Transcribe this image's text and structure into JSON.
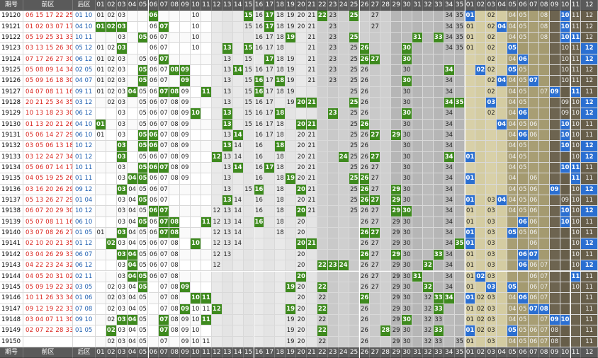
{
  "header": {
    "period": "期号",
    "front": "前区",
    "back": "后区",
    "cols": [
      "01",
      "02",
      "03",
      "04",
      "05",
      "06",
      "07",
      "08",
      "09",
      "10",
      "11",
      "12",
      "13",
      "14",
      "15",
      "16",
      "17",
      "18",
      "19",
      "20",
      "21",
      "22",
      "23",
      "24",
      "25",
      "26",
      "27",
      "28",
      "29",
      "30",
      "31",
      "32",
      "33",
      "34",
      "35",
      "01",
      "02",
      "03",
      "04",
      "05",
      "06",
      "07",
      "08",
      "09",
      "10",
      "11",
      "12"
    ]
  },
  "rows": [
    {
      "p": "19120",
      "f": "06 15 17 22 25",
      "b": "01 10",
      "z": "01 02 03 .. .. 06 .. .. .. 10 .. .. .. .. .. 16 .. 18 19 20 21 .. 23 .. .. .. 27 .. .. .. .. .. .. 34 35 01 .. 02 .. 04 05 .. 08 .. .. 11 12",
      "h": [
        6,
        15,
        17,
        22,
        25
      ],
      "bh": [
        1,
        10
      ]
    },
    {
      "p": "19121",
      "f": "01 02 03 07 17",
      "b": "04 10",
      "z": "01 02 03 .. .. 06 .. .. .. 10 .. .. .. .. 15 16 .. 18 19 20 21 .. 23 .. .. .. 27 .. .. .. .. .. .. 34 35 01 .. 02 .. 04 05 .. 08 .. .. 11 12",
      "h": [
        1,
        2,
        3,
        7,
        17
      ],
      "bh": [
        4,
        10
      ]
    },
    {
      "p": "19122",
      "f": "05 19 25 31 33",
      "b": "10 11",
      "z": ".. .. 03 .. .. 06 07 .. .. 10 .. .. .. .. .. 16 17 18 .. .. 21 .. 23 .. 25 .. .. .. .. .. .. .. .. 34 35 01 .. 02 .. 04 05 .. 08 .. .. 11 12",
      "h": [
        5,
        19,
        25,
        31,
        33
      ],
      "bh": [
        10,
        11
      ]
    },
    {
      "p": "19123",
      "f": "03 13 15 26 30",
      "b": "05 12",
      "z": "01 02 03 .. .. 06 07 .. .. 10 .. .. .. .. .. 16 17 18 .. .. 21 .. 23 .. 25 .. .. .. .. .. .. .. .. 34 35 01 .. 02 .. 04 .. .. .. .. 10 11 12",
      "h": [
        3,
        13,
        15,
        26,
        30
      ],
      "bh": [
        5,
        12
      ]
    },
    {
      "p": "19124",
      "f": "07 17 26 27 30",
      "b": "06 12",
      "z": "01 02 03 .. 05 06 07 .. .. .. .. .. 13 .. 15 .. 17 18 19 .. 21 .. 23 .. 25 26 .. .. .. .. .. .. .. .. .. .. .. 02 .. 04 05 .. .. .. 10 11 12",
      "h": [
        7,
        17,
        26,
        27,
        30
      ],
      "bh": [
        6,
        12
      ]
    },
    {
      "p": "19125",
      "f": "05 08 09 14 34",
      "b": "02 05",
      "z": "01 02 03 .. 05 06 07 .. .. .. .. .. 13 .. 15 16 17 18 19 .. 21 .. 23 .. 25 26 .. .. .. 30 .. .. .. .. .. .. .. 02 .. .. 05 .. .. .. 10 11 12",
      "h": [
        5,
        8,
        9,
        14,
        34
      ],
      "bh": [
        2,
        5
      ]
    },
    {
      "p": "19126",
      "f": "05 09 16 18 30",
      "b": "04 07",
      "z": "01 02 03 .. 05 06 07 .. 09 .. .. .. 13 .. 15 .. 17 .. 19 .. 21 .. 23 .. 25 26 .. .. .. 30 .. .. .. 34 .. .. .. 02 .. 04 05 .. .. .. 10 11 12",
      "h": [
        5,
        9,
        16,
        18,
        30
      ],
      "bh": [
        4,
        7
      ]
    },
    {
      "p": "19127",
      "f": "04 07 08 11 16",
      "b": "09 11",
      "z": "01 02 03 .. 05 06 07 .. 09 .. .. .. 13 .. 15 .. 17 18 19 .. .. .. .. .. 25 26 .. .. .. 30 .. .. .. 34 .. .. .. 02 .. 04 05 .. 07 .. .. 10 11 12",
      "h": [
        4,
        7,
        8,
        11,
        16
      ],
      "bh": [
        9,
        11
      ]
    },
    {
      "p": "19128",
      "f": "20 21 25 34 35",
      "b": "03 12",
      "z": ".. 02 03 .. 05 06 07 08 09 .. .. .. 13 .. 15 16 17 .. 19 .. .. .. .. .. 25 26 .. .. .. 30 .. .. .. 34 .. .. .. 02 .. 04 05 .. .. .. 09 10 11 12",
      "h": [
        20,
        21,
        25,
        34,
        35
      ],
      "bh": [
        3,
        12
      ]
    },
    {
      "p": "19129",
      "f": "10 13 18 23 30",
      "b": "06 12",
      "z": ".. .. 03 .. 05 06 07 08 09 .. .. .. 13 .. 15 16 17 .. .. .. .. .. .. .. 25 26 .. .. .. 30 .. .. .. 34 .. .. .. 02 .. 04 05 .. .. .. 09 10 11 12",
      "h": [
        10,
        13,
        18,
        23,
        30
      ],
      "bh": [
        6,
        12
      ]
    },
    {
      "p": "19130",
      "f": "01 13 20 21 26",
      "b": "04 10",
      "z": ".. .. 03 .. 05 06 07 08 09 .. .. .. 13 .. 15 16 17 18 .. .. .. .. .. .. 25 26 .. .. .. 30 .. .. .. 34 .. .. .. .. .. 04 05 06 .. .. 09 10 11 12",
      "h": [
        1,
        13,
        20,
        21,
        26
      ],
      "bh": [
        4,
        10
      ]
    },
    {
      "p": "19131",
      "f": "05 06 14 27 29",
      "b": "06 10",
      "z": "01 .. 03 .. 05 .. 07 08 09 .. .. .. 13 .. .. 16 17 18 .. 20 21 .. .. .. 25 26 .. .. .. 30 .. .. .. 34 .. .. .. .. .. 04 05 06 .. .. .. 10 11 12",
      "h": [
        5,
        6,
        14,
        27,
        29
      ],
      "bh": [
        6,
        10
      ]
    },
    {
      "p": "19132",
      "f": "03 05 06 13 18",
      "b": "10 12",
      "z": ".. .. 03 .. 05 .. 07 08 09 .. .. .. 13 14 .. 16 .. 18 .. 20 21 .. .. .. 25 26 .. .. .. 30 .. .. .. 34 .. .. .. .. .. 04 05 .. .. .. .. 10 11 12",
      "h": [
        3,
        5,
        6,
        13,
        18
      ],
      "bh": [
        10,
        12
      ]
    },
    {
      "p": "19133",
      "f": "03 12 24 27 34",
      "b": "01 12",
      "z": ".. .. 03 .. 05 06 07 08 09 .. .. .. 13 14 .. 16 .. 18 .. 20 21 .. .. .. 25 26 27 .. .. 30 .. .. .. 34 .. .. .. .. .. 04 05 .. .. .. .. 10 11 12",
      "h": [
        3,
        12,
        24,
        27,
        34
      ],
      "bh": [
        1,
        12
      ]
    },
    {
      "p": "19134",
      "f": "05 06 07 14 17",
      "b": "10 11",
      "z": ".. .. 03 .. 05 06 07 08 09 .. .. .. 13 14 .. 16 .. 18 .. 20 21 .. .. .. 25 26 27 .. .. 30 .. .. .. 34 .. .. .. .. .. 04 05 .. .. .. .. 10 11 12",
      "h": [
        5,
        6,
        7,
        14,
        17
      ],
      "bh": [
        10,
        11
      ]
    },
    {
      "p": "19135",
      "f": "04 05 19 25 26",
      "b": "01 11",
      "z": ".. .. 03 .. 05 06 07 08 09 .. .. .. 13 .. .. 16 .. 18 .. 20 21 .. .. .. 25 26 27 .. .. 30 .. .. .. 34 .. .. .. .. .. 04 .. 06 .. .. .. 10 11 12",
      "h": [
        4,
        5,
        19,
        25,
        26
      ],
      "bh": [
        1,
        11
      ]
    },
    {
      "p": "19136",
      "f": "03 16 20 26 29",
      "b": "09 12",
      "z": ".. .. 03 04 05 06 07 .. .. .. .. .. 13 .. 15 16 .. 18 .. 20 21 .. .. .. 25 26 27 .. .. 30 .. .. .. 34 .. .. .. .. .. 04 05 06 .. .. .. 10 11 12",
      "h": [
        3,
        16,
        20,
        26,
        29
      ],
      "bh": [
        9,
        12
      ]
    },
    {
      "p": "19137",
      "f": "05 13 26 27 29",
      "b": "01 04",
      "z": ".. .. 03 04 05 06 07 .. .. .. .. .. 13 14 .. 16 .. 18 .. 20 21 .. .. .. 25 26 27 .. 29 30 .. .. .. 34 .. 01 .. 03 .. 04 05 06 .. .. 09 10 11 12",
      "h": [
        5,
        13,
        26,
        27,
        29
      ],
      "bh": [
        1,
        4
      ]
    },
    {
      "p": "19138",
      "f": "06 07 20 29 30",
      "b": "10 12",
      "z": ".. .. 03 04 05 06 07 .. .. .. .. 12 13 14 .. 16 .. 18 .. 20 21 .. .. .. 25 26 27 .. 29 30 .. .. .. 34 .. 01 .. 03 .. 04 05 06 .. .. 09 10 11 12",
      "h": [
        6,
        7,
        20,
        29,
        30
      ],
      "bh": [
        10,
        12
      ]
    },
    {
      "p": "19139",
      "f": "05 07 08 11 16",
      "b": "06 10",
      "z": ".. .. 03 04 05 06 07 .. .. .. .. 12 13 14 .. .. .. 18 .. 20 .. .. .. .. .. 26 27 .. 29 30 .. .. .. 34 .. 01 .. 03 .. .. 05 06 .. .. .. 10 11 12",
      "h": [
        5,
        7,
        8,
        11,
        16
      ],
      "bh": [
        6,
        10
      ]
    },
    {
      "p": "19140",
      "f": "03 07 08 26 27",
      "b": "01 05",
      "z": "01 .. 03 04 05 06 07 .. .. .. .. 12 13 14 .. .. .. 18 .. 20 .. .. .. .. .. 26 27 .. 29 30 .. .. .. 34 .. 01 .. 03 .. .. 05 06 .. .. .. 10 11 12",
      "h": [
        3,
        7,
        8,
        26,
        27
      ],
      "bh": [
        1,
        5
      ]
    },
    {
      "p": "19141",
      "f": "02 10 20 21 35",
      "b": "01 12",
      "z": ".. .. 03 04 05 06 07 08 .. .. .. 12 13 14 .. .. .. .. .. 20 .. .. .. .. .. 26 27 .. 29 30 .. .. .. 34 .. 01 .. 03 .. .. .. 06 .. .. .. 10 11 12",
      "h": [
        2,
        10,
        20,
        21,
        35
      ],
      "bh": [
        1,
        12
      ]
    },
    {
      "p": "19142",
      "f": "03 04 26 29 33",
      "b": "06 07",
      "z": ".. .. 03 04 05 06 07 08 .. .. .. 12 13 .. .. .. .. .. .. 20 .. .. .. .. .. 26 27 .. 29 30 .. .. .. 34 .. 01 .. 03 .. .. .. 06 .. .. .. 10 11 12",
      "h": [
        3,
        4,
        26,
        29,
        33
      ],
      "bh": [
        6,
        7
      ]
    },
    {
      "p": "19143",
      "f": "04 22 23 24 32",
      "b": "06 12",
      "z": ".. .. 03 04 05 06 07 08 .. .. .. 12 .. .. .. .. .. .. .. 20 .. .. .. .. .. 26 27 .. 29 30 .. .. .. 34 .. 01 .. 03 .. .. .. 06 07 .. .. 10 11 12",
      "h": [
        4,
        22,
        23,
        24,
        32
      ],
      "bh": [
        6,
        12
      ]
    },
    {
      "p": "19144",
      "f": "04 05 20 31 02 11",
      "b": "02 11",
      "z": ".. .. 03 04 05 06 07 08 .. .. .. .. .. .. .. .. .. .. .. 20 .. .. .. .. .. 26 27 .. 29 30 .. .. .. 34 .. 01 .. 03 .. .. .. 06 07 .. .. 10 11 12",
      "h": [
        4,
        5,
        20,
        31
      ],
      "bh": [
        2,
        11
      ]
    },
    {
      "p": "19145",
      "f": "05 09 19 22 32",
      "b": "03 05",
      "z": ".. 02 03 04 05 .. 07 08 .. .. .. .. .. .. .. .. .. .. .. 20 .. .. .. .. .. 26 27 .. 29 30 .. .. .. 34 .. 01 .. 03 .. .. .. 06 07 .. .. 10 11 12",
      "h": [
        5,
        9,
        19,
        22,
        32
      ],
      "bh": [
        3,
        5
      ]
    },
    {
      "p": "19146",
      "f": "10 11 26 33 34",
      "b": "01 06",
      "z": ".. 02 03 04 05 .. 07 08 .. .. .. .. .. .. .. .. .. .. .. 20 .. 22 .. .. .. 26 .. .. 29 30 .. 32 .. .. .. .. 02 03 .. 04 05 06 07 .. .. .. 11 12",
      "h": [
        10,
        11,
        26,
        33,
        34
      ],
      "bh": [
        1,
        6
      ]
    },
    {
      "p": "19147",
      "f": "09 12 19 22 33",
      "b": "07 08",
      "z": ".. 02 03 04 05 .. 07 08 .. 10 11 .. .. .. .. .. .. .. .. 20 .. 22 .. .. .. 26 .. .. 29 30 .. 32 33 .. .. 01 02 03 .. 04 05 06 07 .. .. .. 11 12",
      "h": [
        9,
        12,
        19,
        22,
        33
      ],
      "bh": [
        7,
        8
      ]
    },
    {
      "p": "19148",
      "f": "03 04 07 11 30",
      "b": "09 10",
      "z": ".. 02 03 04 05 .. 07 08 09 10 11 .. .. .. .. .. .. .. 19 20 .. 22 .. .. .. 26 .. .. 29 30 .. 32 33 .. .. 01 02 03 .. 04 05 .. 07 .. .. .. 11 12",
      "h": [
        3,
        4,
        7,
        11,
        30
      ],
      "bh": [
        9,
        10
      ]
    },
    {
      "p": "19149",
      "f": "02 07 22 28 33",
      "b": "01 05",
      "z": ".. 02 03 04 05 .. 07 08 09 10 .. .. .. .. .. .. .. .. 19 20 .. 22 .. .. .. 26 .. .. 29 30 .. 32 33 .. .. 01 02 03 .. 04 05 06 07 08 .. .. 11 12",
      "h": [
        2,
        7,
        22,
        28,
        33
      ],
      "bh": [
        1,
        5
      ]
    },
    {
      "p": "19150",
      "f": "",
      "b": "",
      "z": ".. 02 03 04 05 .. 07 .. 09 10 11 .. .. .. .. .. .. .. 19 20 .. 22 .. .. .. 26 .. .. 29 30 .. 32 33 .. 35 01 .. 03 .. 04 05 06 07 08 .. .. 11 12",
      "h": [],
      "bh": []
    }
  ],
  "colors": {
    "header": "#5a5a5a",
    "hit": "#3e8a1e",
    "back_hit": "#2b6fd1",
    "front_text": "#d9241d",
    "back_text": "#1f5fb0"
  }
}
